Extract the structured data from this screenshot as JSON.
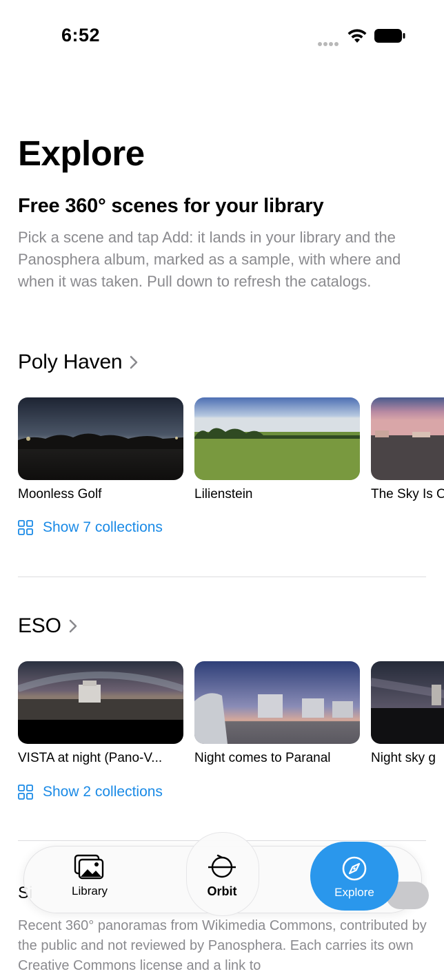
{
  "status": {
    "time": "6:52"
  },
  "page": {
    "title": "Explore",
    "headline": "Free 360° scenes for your library",
    "intro": "Pick a scene and tap Add: it lands in your library and the Panosphera album, marked as a sample, with where and when it was taken. Pull down to refresh the catalogs."
  },
  "sections": [
    {
      "title": "Poly Haven",
      "items": [
        {
          "caption": "Moonless Golf"
        },
        {
          "caption": "Lilienstein"
        },
        {
          "caption": "The Sky Is On Fire"
        }
      ],
      "show_label": "Show 7 collections"
    },
    {
      "title": "ESO",
      "items": [
        {
          "caption": "VISTA at night (Pano-V..."
        },
        {
          "caption": "Night comes to Paranal"
        },
        {
          "caption": "Night sky g"
        }
      ],
      "show_label": "Show 2 collections"
    }
  ],
  "wikimedia": {
    "title_partial": "Si",
    "description": "Recent 360° panoramas from Wikimedia Commons, contributed by the public and not reviewed by Panosphera. Each carries its own Creative Commons license and a link to"
  },
  "tabbar": {
    "tabs": [
      {
        "label": "Library",
        "icon": "photo-stack-icon"
      },
      {
        "label": "Orbit",
        "icon": "orbit-icon"
      },
      {
        "label": "Explore",
        "icon": "compass-icon",
        "selected": true
      }
    ],
    "accent": "#2a97ec"
  },
  "colors": {
    "link": "#1a8ae6",
    "secondary_text": "#8a8a8e"
  }
}
